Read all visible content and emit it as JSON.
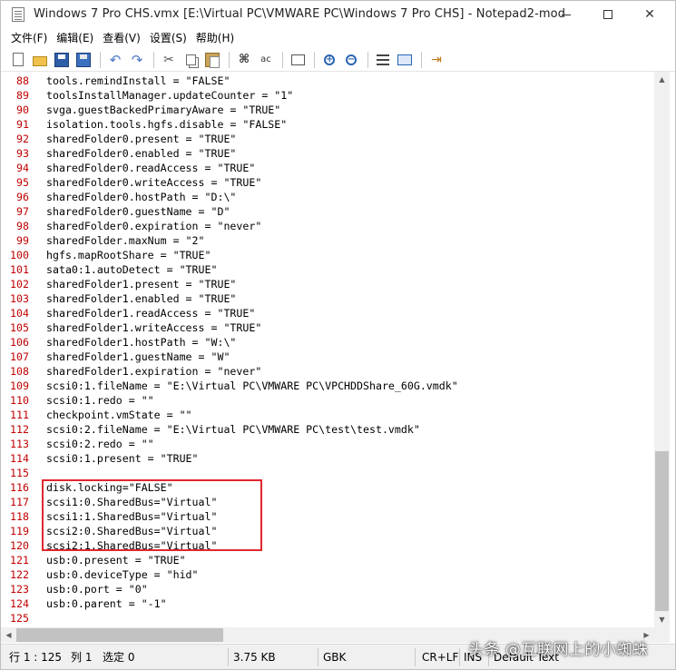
{
  "window": {
    "title": "Windows 7 Pro CHS.vmx [E:\\Virtual PC\\VMWARE PC\\Windows 7 Pro CHS] - Notepad2-mod"
  },
  "menu": [
    "文件(F)",
    "编辑(E)",
    "查看(V)",
    "设置(S)",
    "帮助(H)"
  ],
  "toolbar": {
    "buttons": [
      "new",
      "open",
      "save",
      "save-as",
      "undo",
      "redo",
      "cut",
      "copy",
      "paste",
      "find",
      "replace",
      "goto",
      "zoom-in",
      "zoom-out",
      "list-view",
      "view-toggle",
      "exit"
    ]
  },
  "editor": {
    "lines": [
      {
        "num": "88",
        "text": "tools.remindInstall = \"FALSE\""
      },
      {
        "num": "89",
        "text": "toolsInstallManager.updateCounter = \"1\""
      },
      {
        "num": "90",
        "text": "svga.guestBackedPrimaryAware = \"TRUE\""
      },
      {
        "num": "91",
        "text": "isolation.tools.hgfs.disable = \"FALSE\""
      },
      {
        "num": "92",
        "text": "sharedFolder0.present = \"TRUE\""
      },
      {
        "num": "93",
        "text": "sharedFolder0.enabled = \"TRUE\""
      },
      {
        "num": "94",
        "text": "sharedFolder0.readAccess = \"TRUE\""
      },
      {
        "num": "95",
        "text": "sharedFolder0.writeAccess = \"TRUE\""
      },
      {
        "num": "96",
        "text": "sharedFolder0.hostPath = \"D:\\\""
      },
      {
        "num": "97",
        "text": "sharedFolder0.guestName = \"D\""
      },
      {
        "num": "98",
        "text": "sharedFolder0.expiration = \"never\""
      },
      {
        "num": "99",
        "text": "sharedFolder.maxNum = \"2\""
      },
      {
        "num": "100",
        "text": "hgfs.mapRootShare = \"TRUE\""
      },
      {
        "num": "101",
        "text": "sata0:1.autoDetect = \"TRUE\""
      },
      {
        "num": "102",
        "text": "sharedFolder1.present = \"TRUE\""
      },
      {
        "num": "103",
        "text": "sharedFolder1.enabled = \"TRUE\""
      },
      {
        "num": "104",
        "text": "sharedFolder1.readAccess = \"TRUE\""
      },
      {
        "num": "105",
        "text": "sharedFolder1.writeAccess = \"TRUE\""
      },
      {
        "num": "106",
        "text": "sharedFolder1.hostPath = \"W:\\\""
      },
      {
        "num": "107",
        "text": "sharedFolder1.guestName = \"W\""
      },
      {
        "num": "108",
        "text": "sharedFolder1.expiration = \"never\""
      },
      {
        "num": "109",
        "text": "scsi0:1.fileName = \"E:\\Virtual PC\\VMWARE PC\\VPCHDDShare_60G.vmdk\""
      },
      {
        "num": "110",
        "text": "scsi0:1.redo = \"\""
      },
      {
        "num": "111",
        "text": "checkpoint.vmState = \"\""
      },
      {
        "num": "112",
        "text": "scsi0:2.fileName = \"E:\\Virtual PC\\VMWARE PC\\test\\test.vmdk\""
      },
      {
        "num": "113",
        "text": "scsi0:2.redo = \"\""
      },
      {
        "num": "114",
        "text": "scsi0:1.present = \"TRUE\""
      },
      {
        "num": "115",
        "text": ""
      },
      {
        "num": "116",
        "text": "disk.locking=\"FALSE\""
      },
      {
        "num": "117",
        "text": "scsi1:0.SharedBus=\"Virtual\""
      },
      {
        "num": "118",
        "text": "scsi1:1.SharedBus=\"Virtual\""
      },
      {
        "num": "119",
        "text": "scsi2:0.SharedBus=\"Virtual\""
      },
      {
        "num": "120",
        "text": "scsi2:1.SharedBus=\"Virtual\""
      },
      {
        "num": "121",
        "text": "usb:0.present = \"TRUE\""
      },
      {
        "num": "122",
        "text": "usb:0.deviceType = \"hid\""
      },
      {
        "num": "123",
        "text": "usb:0.port = \"0\""
      },
      {
        "num": "124",
        "text": "usb:0.parent = \"-1\""
      },
      {
        "num": "125",
        "text": ""
      }
    ]
  },
  "statusbar": {
    "position": "行 1 : 125",
    "column": "列 1",
    "selection": "选定 0",
    "size": "3.75 KB",
    "encoding": "GBK",
    "line_ending": "CR+LF",
    "mode": "INS",
    "scheme": "Default Text"
  },
  "watermark": "头条 @互联网上的小蜘蛛",
  "colors": {
    "line_numbers": "#c00000",
    "highlight_box": "#e0282e"
  }
}
